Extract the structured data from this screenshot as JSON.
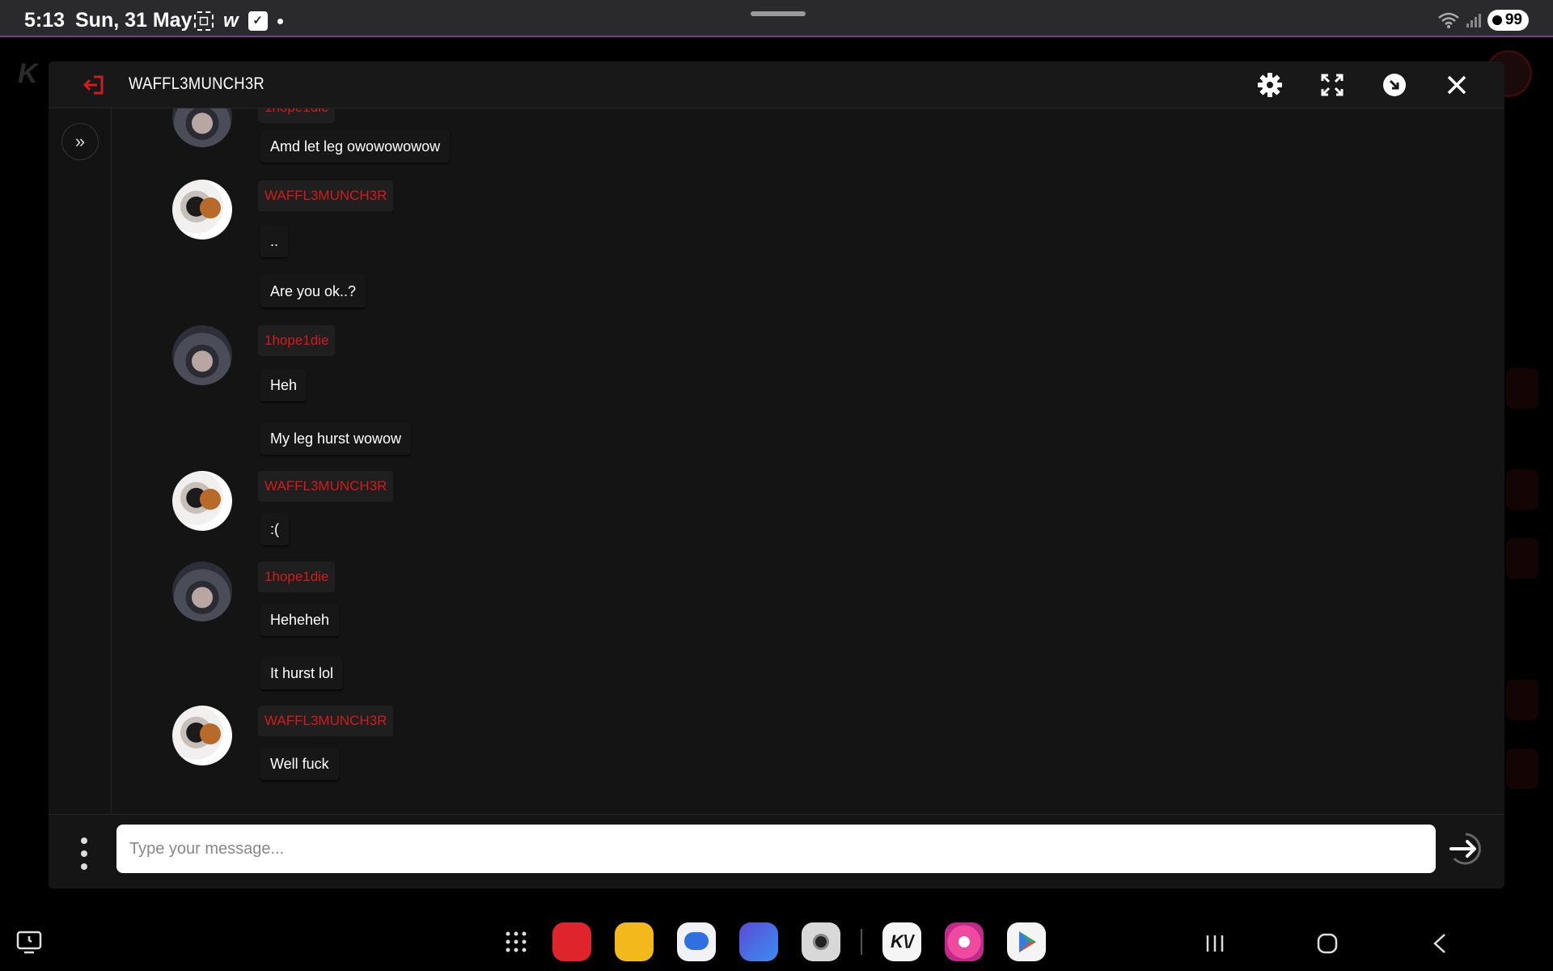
{
  "status_bar": {
    "time": "5:13",
    "date": "Sun, 31 May",
    "battery": "99",
    "icons": [
      "screenshot-icon",
      "webtoon-icon",
      "checkbox-icon",
      "dot-icon"
    ]
  },
  "chat": {
    "title": "WAFFL3MUNCH3R",
    "accent_color": "#d21b1b",
    "messages": [
      {
        "type": "text",
        "text": "Amd let leg owowowowow"
      },
      {
        "type": "user",
        "name": "WAFFL3MUNCH3R",
        "avatar": "waffle"
      },
      {
        "type": "text",
        "text": ".."
      },
      {
        "type": "text",
        "text": "Are you ok..?"
      },
      {
        "type": "user",
        "name": "1hope1die",
        "avatar": "hope"
      },
      {
        "type": "text",
        "text": "Heh"
      },
      {
        "type": "text",
        "text": "My leg hurst wowow"
      },
      {
        "type": "user",
        "name": "WAFFL3MUNCH3R",
        "avatar": "waffle"
      },
      {
        "type": "text",
        "text": ":("
      },
      {
        "type": "user",
        "name": "1hope1die",
        "avatar": "hope"
      },
      {
        "type": "text",
        "text": "Heheheh"
      },
      {
        "type": "text",
        "text": "It hurst lol"
      },
      {
        "type": "user",
        "name": "WAFFL3MUNCH3R",
        "avatar": "waffle"
      },
      {
        "type": "text",
        "text": "Well fuck"
      }
    ],
    "input": {
      "placeholder": "Type your message..."
    }
  },
  "dock": {
    "apps": [
      "app-drawer-icon",
      "notes-icon",
      "files-icon",
      "messages-icon",
      "internet-icon",
      "camera-icon",
      "kv-app-icon",
      "gallery-icon",
      "play-store-icon"
    ]
  }
}
